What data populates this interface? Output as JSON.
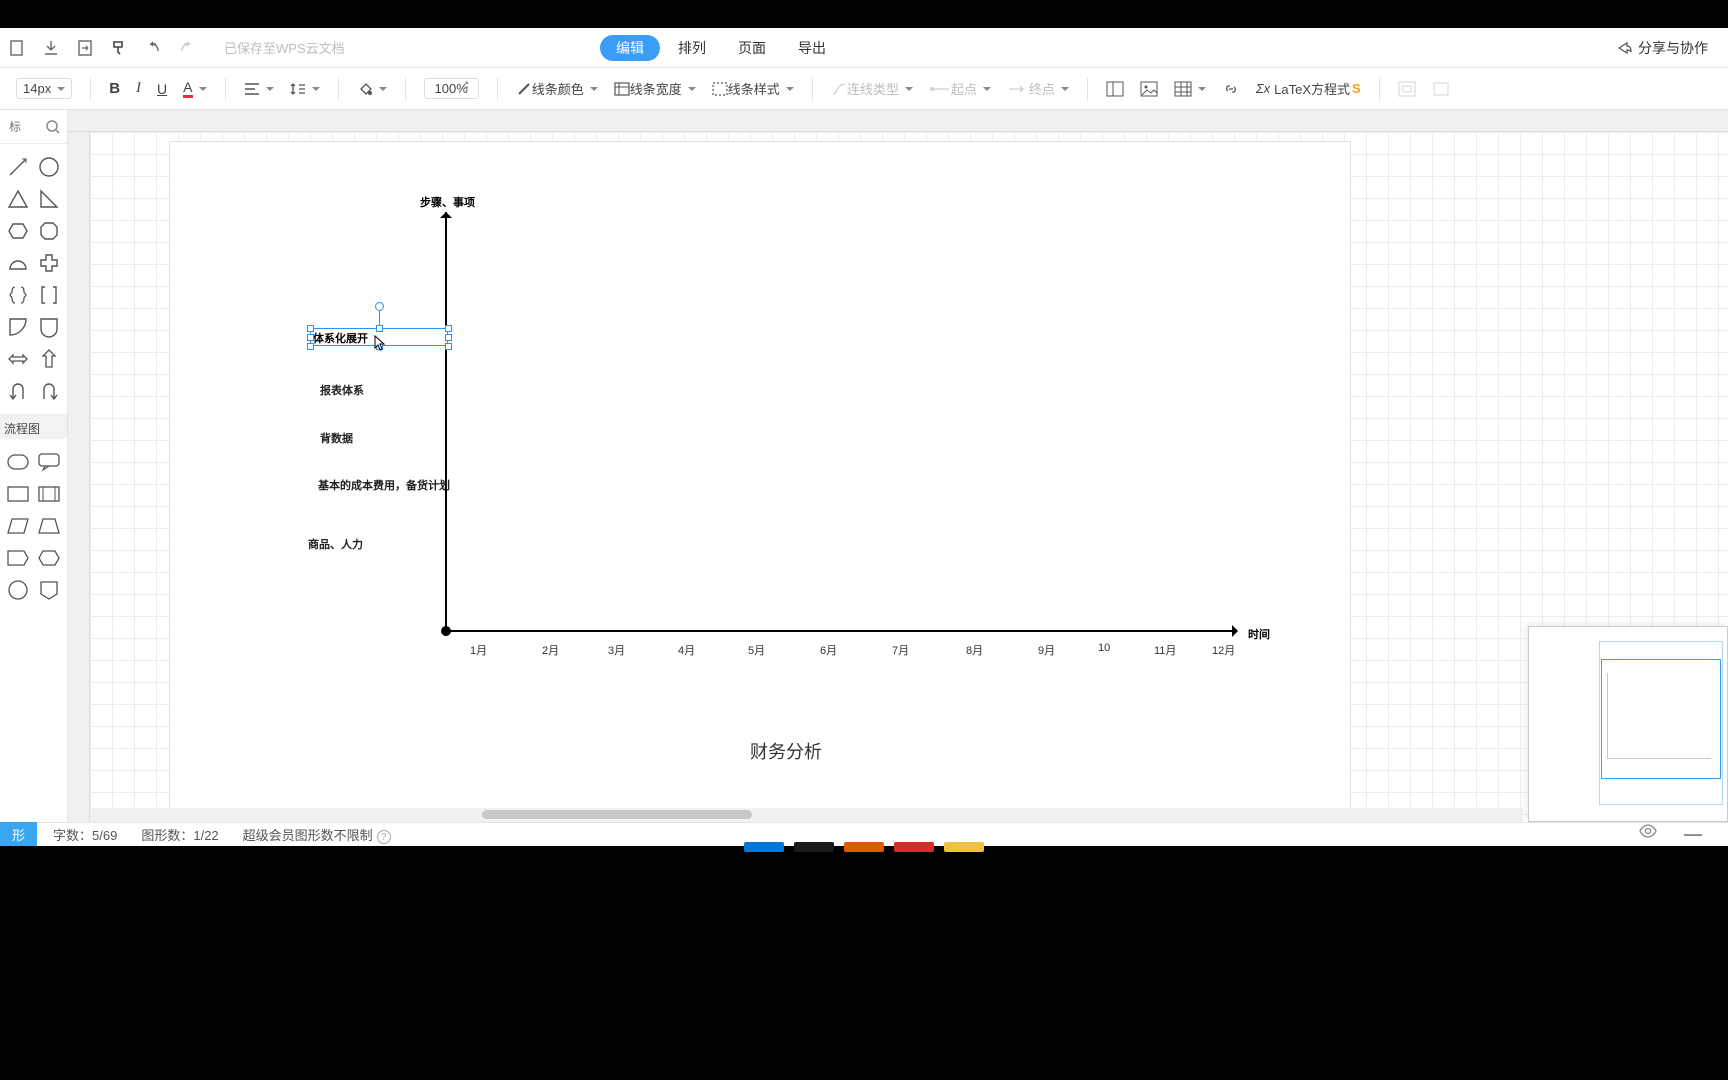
{
  "toolbar1": {
    "saved_text": "已保存至WPS云文档",
    "tabs": {
      "edit": "编辑",
      "arrange": "排列",
      "page": "页面",
      "export": "导出"
    },
    "share": "分享与协作"
  },
  "toolbar2": {
    "font_size": "14px",
    "zoom": "100%",
    "line_color": "线条颜色",
    "line_width": "线条宽度",
    "line_style": "线条样式",
    "conn_type": "连线类型",
    "start_point": "起点",
    "end_point": "终点",
    "latex": "LaTeX方程式"
  },
  "left_panel": {
    "search_placeholder": "标",
    "section_flowchart": "流程图",
    "bottom_tag": "形"
  },
  "canvas": {
    "y_axis_title": "步骤、事项",
    "x_axis_title": "时间",
    "selected_text": "体系化展开",
    "y_labels": {
      "l1": "报表体系",
      "l2": "背数据",
      "l3": "基本的成本费用，备货计划",
      "l4": "商品、人力"
    },
    "months": [
      "1月",
      "2月",
      "3月",
      "4月",
      "5月",
      "6月",
      "7月",
      "8月",
      "9月",
      "10",
      "11月",
      "12月"
    ],
    "big_title": "财务分析"
  },
  "status": {
    "tag": "形",
    "words": "字数：",
    "words_val": "5/69",
    "shapes": "图形数：",
    "shapes_val": "1/22",
    "vip": "超级会员图形数不限制"
  },
  "chart_data": {
    "type": "scatter",
    "title": "财务分析",
    "xlabel": "时间",
    "ylabel": "步骤、事项",
    "x_categories": [
      "1月",
      "2月",
      "3月",
      "4月",
      "5月",
      "6月",
      "7月",
      "8月",
      "9月",
      "10月",
      "11月",
      "12月"
    ],
    "y_categories": [
      "商品、人力",
      "基本的成本费用，备货计划",
      "背数据",
      "报表体系",
      "体系化展开"
    ],
    "series": []
  }
}
